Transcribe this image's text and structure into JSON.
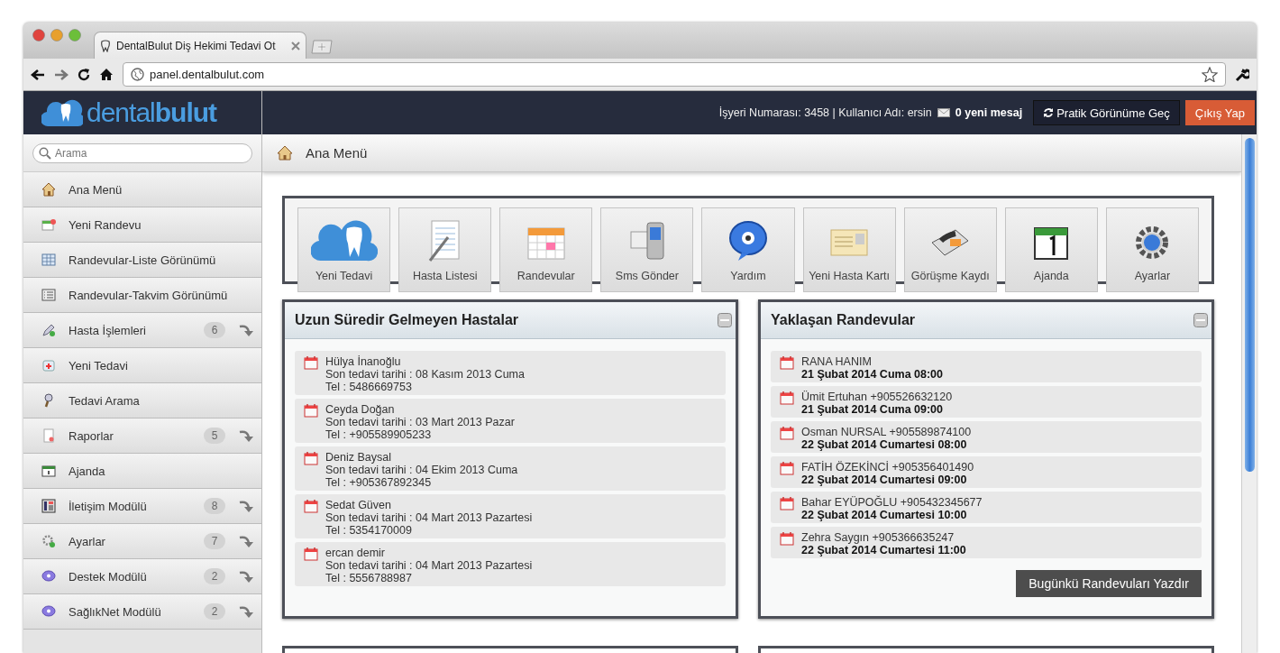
{
  "browser": {
    "tab_title": "DentalBulut Diş Hekimi Tedavi Ot",
    "url": "panel.dentalbulut.com"
  },
  "header": {
    "logo": "dental**bulut**",
    "info": "İşyeri Numarası: 3458 | Kullanıcı Adı: ersin",
    "messages": "0 yeni mesaj",
    "buttons": [
      {
        "label": "Pratik Görünüme Geç",
        "kind": "switch"
      },
      {
        "label": "Çıkış Yap",
        "kind": "logout"
      }
    ]
  },
  "sidebar": {
    "search": {
      "placeholder": "Arama"
    },
    "items": [
      {
        "label": "Ana Menü"
      },
      {
        "label": "Yeni Randevu"
      },
      {
        "label": "Randevular-Liste Görünümü"
      },
      {
        "label": "Randevular-Takvim Görünümü"
      },
      {
        "label": "Hasta İşlemleri",
        "count": "6"
      },
      {
        "label": "Yeni Tedavi"
      },
      {
        "label": "Tedavi Arama"
      },
      {
        "label": "Raporlar",
        "count": "5"
      },
      {
        "label": "Ajanda"
      },
      {
        "label": "İletişim Modülü",
        "count": "8"
      },
      {
        "label": "Ayarlar",
        "count": "7"
      },
      {
        "label": "Destek Modülü",
        "count": "2"
      },
      {
        "label": "SağlıkNet Modülü",
        "count": "2"
      }
    ]
  },
  "breadcrumb": {
    "label": "Ana Menü"
  },
  "shortcuts": [
    "Yeni Tedavi",
    "Hasta Listesi",
    "Randevular",
    "Sms Gönder",
    "Yardım",
    "Yeni Hasta Kartı",
    "Görüşme Kaydı",
    "Ajanda",
    "Ayarlar"
  ],
  "panels": [
    {
      "title": "Uzun Süredir Gelmeyen Hastalar",
      "items": [
        {
          "name": "Hülya İnanoğlu",
          "last_visit": "Son tedavi tarihi : 08 Kasım 2013 Cuma",
          "phone": "Tel : 5486669753"
        },
        {
          "name": "Ceyda Doğan",
          "last_visit": "Son tedavi tarihi : 03 Mart 2013 Pazar",
          "phone": "Tel : +905589905233"
        },
        {
          "name": "Deniz Baysal",
          "last_visit": "Son tedavi tarihi : 04 Ekim 2013 Cuma",
          "phone": "Tel : +905367892345"
        },
        {
          "name": "Sedat Güven",
          "last_visit": "Son tedavi tarihi : 04 Mart 2013 Pazartesi",
          "phone": "Tel : 5354170009"
        },
        {
          "name": "ercan demir",
          "last_visit": "Son tedavi tarihi : 04 Mart 2013 Pazartesi",
          "phone": "Tel : 5556788987"
        }
      ]
    },
    {
      "title": "Yaklaşan Randevular",
      "button": "Bugünkü Randevuları Yazdır",
      "items": [
        {
          "name": "RANA HANIM",
          "when": "21 Şubat 2014 Cuma 08:00"
        },
        {
          "name": "Ümit Ertuhan +905526632120",
          "when": "21 Şubat 2014 Cuma 09:00"
        },
        {
          "name": "Osman NURSAL +905589874100",
          "when": "22 Şubat 2014 Cumartesi 08:00"
        },
        {
          "name": "FATİH ÖZEKİNCİ +905356401490",
          "when": "22 Şubat 2014 Cumartesi 09:00"
        },
        {
          "name": "Bahar EYÜPOĞLU +905432345677",
          "when": "22 Şubat 2014 Cumartesi 10:00"
        },
        {
          "name": "Zehra Saygın +905366635247",
          "when": "22 Şubat 2014 Cumartesi 11:00"
        }
      ]
    }
  ]
}
